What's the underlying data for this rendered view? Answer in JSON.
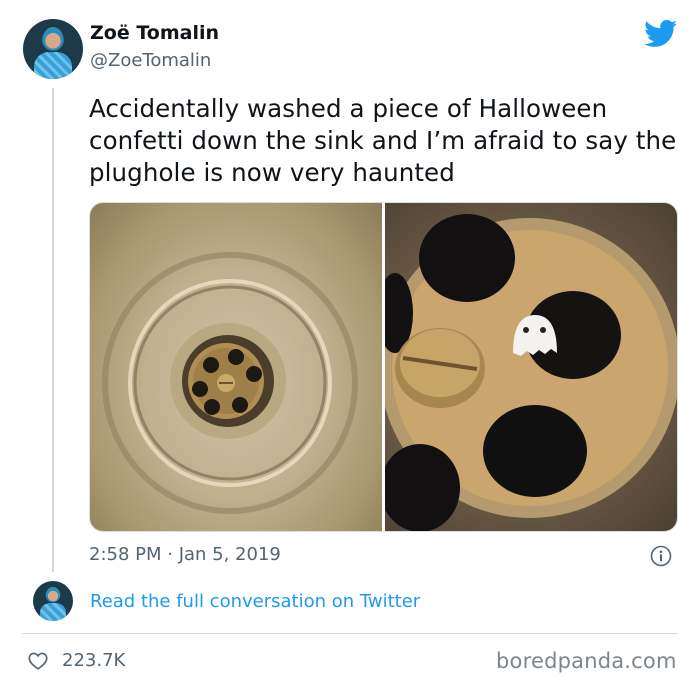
{
  "author": {
    "name": "Zoë Tomalin",
    "handle": "@ZoeTomalin"
  },
  "tweet": {
    "text": "Accidentally washed a piece of Halloween confetti down the sink and I’m afraid to say the plughole is now very haunted",
    "timestamp": "2:58 PM · Jan 5, 2019"
  },
  "conversation": {
    "link_label": "Read the full conversation on Twitter"
  },
  "stats": {
    "likes": "223.7K"
  },
  "watermark": "boredpanda.com",
  "icons": {
    "brand": "twitter-bird-icon",
    "info": "info-icon",
    "like": "heart-icon"
  },
  "colors": {
    "accent": "#1d9bf0",
    "secondary_text": "#536471",
    "primary_text": "#0f1419"
  }
}
